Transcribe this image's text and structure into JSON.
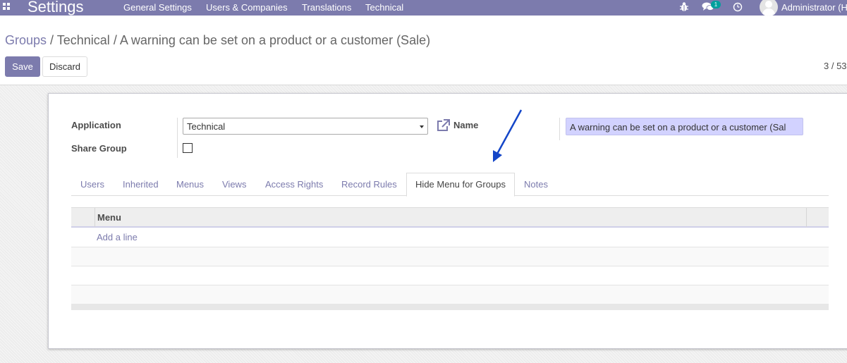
{
  "navbar": {
    "app_title": "Settings",
    "menus": [
      "General Settings",
      "Users & Companies",
      "Translations",
      "Technical"
    ],
    "messages_count": "1",
    "user_name": "Administrator (H"
  },
  "breadcrumb": {
    "root": "Groups",
    "separator": "/",
    "middle": "Technical",
    "current": "A warning can be set on a product or a customer (Sale)"
  },
  "buttons": {
    "save": "Save",
    "discard": "Discard"
  },
  "pager": "3 / 53",
  "form": {
    "application_label": "Application",
    "application_value": "Technical",
    "share_group_label": "Share Group",
    "share_group_checked": false,
    "name_label": "Name",
    "name_value": "A warning can be set on a product or a customer (Sal"
  },
  "tabs": [
    "Users",
    "Inherited",
    "Menus",
    "Views",
    "Access Rights",
    "Record Rules",
    "Hide Menu for Groups",
    "Notes"
  ],
  "active_tab": "Hide Menu for Groups",
  "table": {
    "column_header": "Menu",
    "add_line": "Add a line"
  },
  "colors": {
    "brand": "#7c7bad",
    "name_field_bg": "#d2d2ff",
    "badge": "#00a09d",
    "annotation_arrow": "#1446c8"
  }
}
